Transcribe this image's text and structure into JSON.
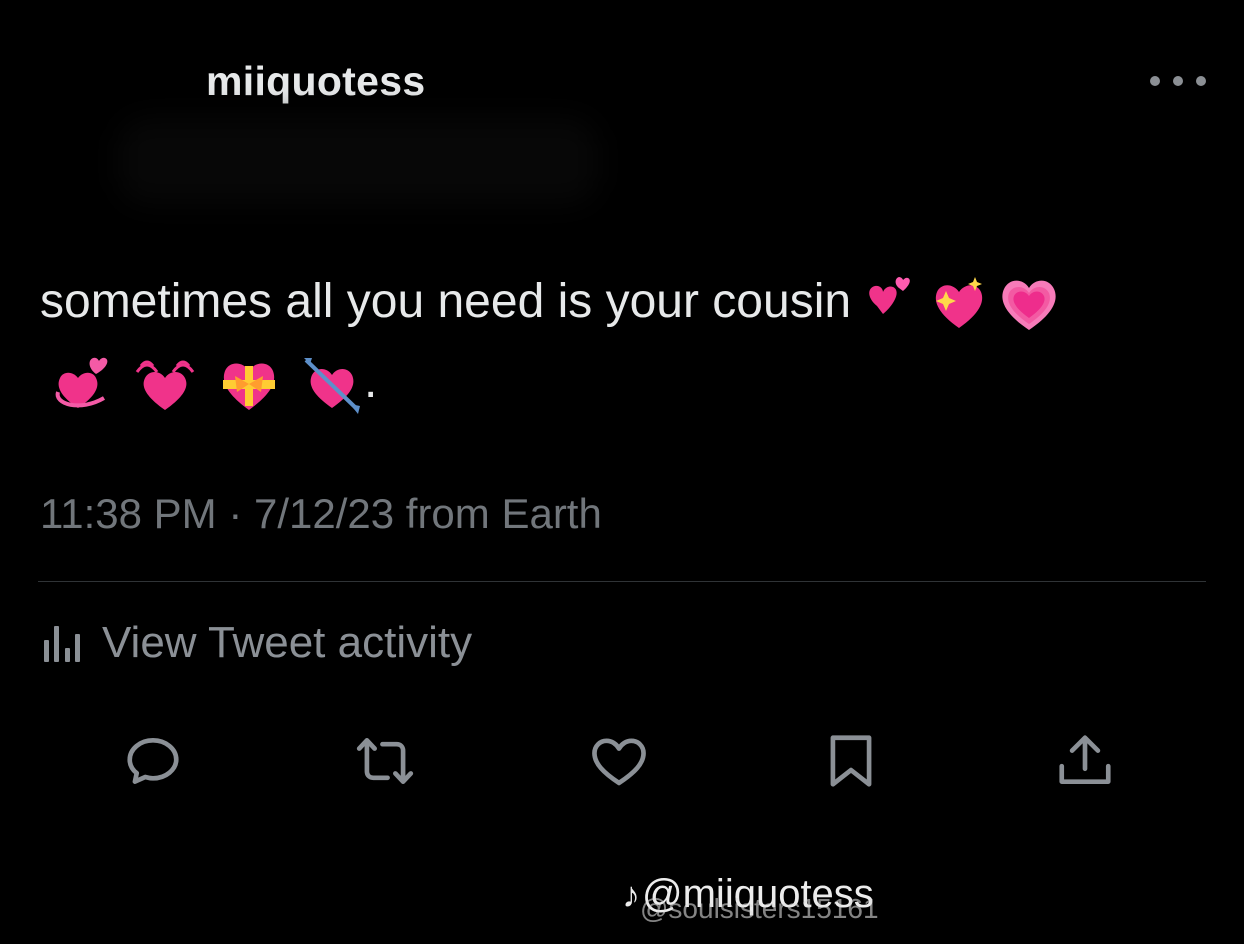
{
  "tweet": {
    "username": "miiquotess",
    "text": "sometimes all you need is your cousin",
    "trailing": ".",
    "emojis_row1": [
      "two-hearts-icon",
      "sparkling-heart-icon",
      "growing-heart-icon"
    ],
    "emojis_row2": [
      "revolving-hearts-icon",
      "beating-heart-icon",
      "heart-with-ribbon-icon",
      "heart-with-arrow-icon"
    ],
    "meta": "11:38 PM · 7/12/23 from Earth",
    "activity_label": "View Tweet activity"
  },
  "actions": [
    "reply-icon",
    "retweet-icon",
    "like-icon",
    "bookmark-icon",
    "share-icon"
  ],
  "watermark": {
    "primary": "@miiquotess",
    "secondary": "@soulsisters15161"
  },
  "colors": {
    "background": "#000000",
    "text": "#e7e9ea",
    "secondary_text": "#71767b",
    "heart_pink": "#f0338a"
  }
}
